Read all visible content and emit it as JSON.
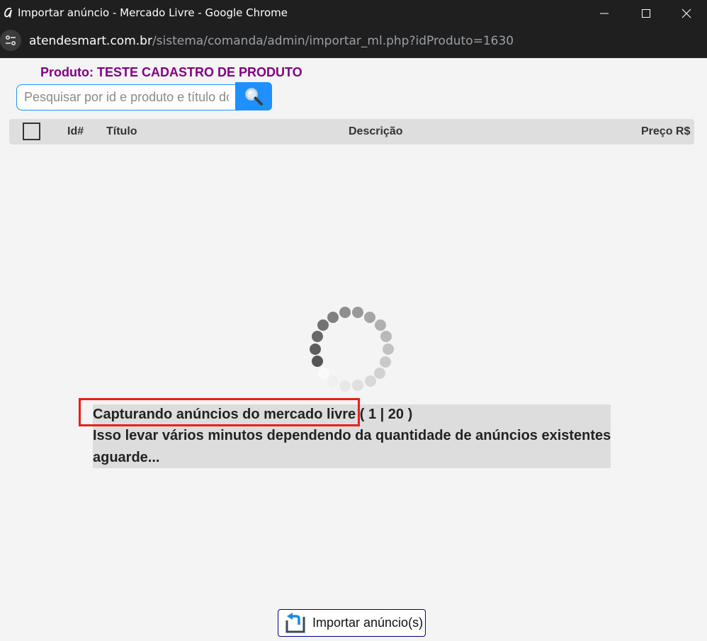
{
  "window": {
    "title": "Importar anúncio - Mercado Livre - Google Chrome",
    "app_icon": "chrome-app-icon",
    "controls": [
      "minimize-icon",
      "maximize-icon",
      "close-icon"
    ]
  },
  "address_bar": {
    "host": "atendesmart.com.br",
    "path": "/sistema/comanda/admin/importar_ml.php?idProduto=1630",
    "site_info_icon": "site-settings-icon"
  },
  "page": {
    "product_title": "Produto: TESTE CADASTRO DE PRODUTO",
    "search": {
      "placeholder": "Pesquisar por id e produto e título do anúncio",
      "value": "",
      "button_icon": "magnifier-icon"
    },
    "table": {
      "columns": [
        "Id#",
        "Título",
        "Descrição",
        "Preço R$"
      ]
    },
    "loading": {
      "spinner_icon": "loading-spinner-icon",
      "status_main": "Capturando anúncios do mercado livre",
      "counter": "( 1 | 20 )",
      "line2": "Isso levar vários minutos dependendo da quantidade de anúncios existentes",
      "line3": "aguarde..."
    },
    "import_button": {
      "label": "Importar anúncio(s)",
      "icon": "import-arrow-icon"
    }
  },
  "colors": {
    "chrome_bar": "#1f1f1f",
    "product_title": "#800080",
    "accent_blue": "#1e90ff",
    "highlight_red": "#e8201c",
    "message_bg": "#dddddd"
  }
}
